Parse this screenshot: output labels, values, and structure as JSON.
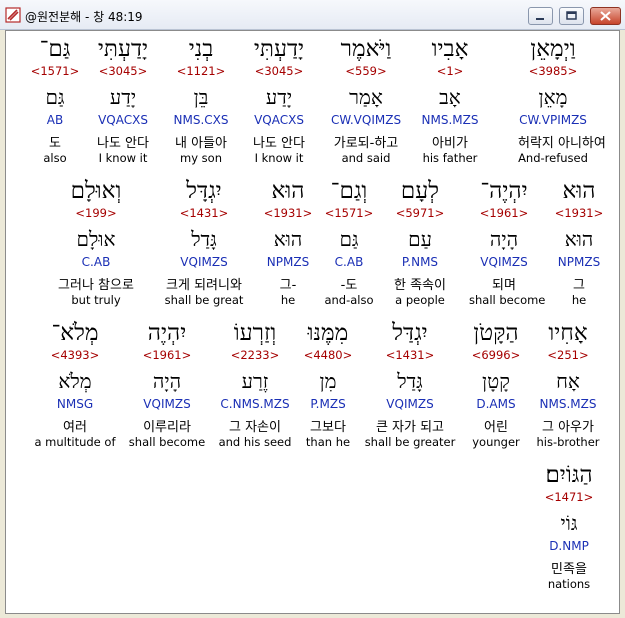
{
  "window": {
    "title": "@원전분해 - 창 48:19"
  },
  "rows": [
    {
      "words": [
        {
          "heb": "וַיְמָאֵן",
          "strong": "<3985>",
          "lemma": "מָאֵן",
          "morph": "CW.VPIMZS",
          "kor": "허락지 아니하여",
          "eng": "And-refused"
        },
        {
          "heb": "אָבִיו",
          "strong": "<1>",
          "lemma": "אָב",
          "morph": "NMS.MZS",
          "kor": "아비가",
          "eng": "his father"
        },
        {
          "heb": "וַיֹּאמֶר",
          "strong": "<559>",
          "lemma": "אָמַר",
          "morph": "CW.VQIMZS",
          "kor": "가로되-하고",
          "eng": "and said"
        },
        {
          "heb": "יָדַעְתִּי",
          "strong": "<3045>",
          "lemma": "יָדַע",
          "morph": "VQACXS",
          "kor": "나도 안다",
          "eng": "I know it"
        },
        {
          "heb": "בְנִי",
          "strong": "<1121>",
          "lemma": "בֵּן",
          "morph": "NMS.CXS",
          "kor": "내 아들아",
          "eng": "my son"
        },
        {
          "heb": "יָדַעְתִּי",
          "strong": "<3045>",
          "lemma": "יָדַע",
          "morph": "VQACXS",
          "kor": "나도 안다",
          "eng": "I know it"
        },
        {
          "heb": "גַּם־",
          "strong": "<1571>",
          "lemma": "גַּם",
          "morph": "AB",
          "kor": "도",
          "eng": "also"
        }
      ]
    },
    {
      "words": [
        {
          "heb": "הוּא",
          "strong": "<1931>",
          "lemma": "הוּא",
          "morph": "NPMZS",
          "kor": "그",
          "eng": "he"
        },
        {
          "heb": "יִהְיֶה־",
          "strong": "<1961>",
          "lemma": "הָיָה",
          "morph": "VQIMZS",
          "kor": "되며",
          "eng": "shall become"
        },
        {
          "heb": "לְעָם",
          "strong": "<5971>",
          "lemma": "עַם",
          "morph": "P.NMS",
          "kor": "한 족속이",
          "eng": "a people"
        },
        {
          "heb": "וְגַם־",
          "strong": "<1571>",
          "lemma": "גַּם",
          "morph": "C.AB",
          "kor": "-도",
          "eng": "and-also"
        },
        {
          "heb": "הוּא",
          "strong": "<1931>",
          "lemma": "הוּא",
          "morph": "NPMZS",
          "kor": "그-",
          "eng": "he"
        },
        {
          "heb": "יִגְדָּל",
          "strong": "<1431>",
          "lemma": "גָּדַל",
          "morph": "VQIMZS",
          "kor": "크게 되려니와",
          "eng": "shall be great"
        },
        {
          "heb": "וְאוּלָם",
          "strong": "<199>",
          "lemma": "אוּלָם",
          "morph": "C.AB",
          "kor": "그러나 참으로",
          "eng": "but truly"
        }
      ]
    },
    {
      "words": [
        {
          "heb": "אָחִיו",
          "strong": "<251>",
          "lemma": "אָח",
          "morph": "NMS.MZS",
          "kor": "그 아우가",
          "eng": "his-brother"
        },
        {
          "heb": "הַקָּטֹן",
          "strong": "<6996>",
          "lemma": "קָטָן",
          "morph": "D.AMS",
          "kor": "어린",
          "eng": "younger"
        },
        {
          "heb": "יִגְדַּל",
          "strong": "<1431>",
          "lemma": "גָּדַל",
          "morph": "VQIMZS",
          "kor": "큰 자가 되고",
          "eng": "shall be greater"
        },
        {
          "heb": "מִמֶּנּוּ",
          "strong": "<4480>",
          "lemma": "מִן",
          "morph": "P.MZS",
          "kor": "그보다",
          "eng": "than he"
        },
        {
          "heb": "וְזַרְעוֹ",
          "strong": "<2233>",
          "lemma": "זֶרַע",
          "morph": "C.NMS.MZS",
          "kor": "그 자손이",
          "eng": "and his seed"
        },
        {
          "heb": "יִהְיֶה",
          "strong": "<1961>",
          "lemma": "הָיָה",
          "morph": "VQIMZS",
          "kor": "이루리라",
          "eng": "shall become"
        },
        {
          "heb": "מְלֹא־",
          "strong": "<4393>",
          "lemma": "מְלֹא",
          "morph": "NMSG",
          "kor": "여러",
          "eng": "a multitude of"
        }
      ]
    },
    {
      "words": [
        {
          "heb": "הַגּוֹיִם׃",
          "strong": "<1471>",
          "lemma": "גּוֹי",
          "morph": "D.NMP",
          "kor": "민족을",
          "eng": "nations"
        }
      ]
    }
  ]
}
